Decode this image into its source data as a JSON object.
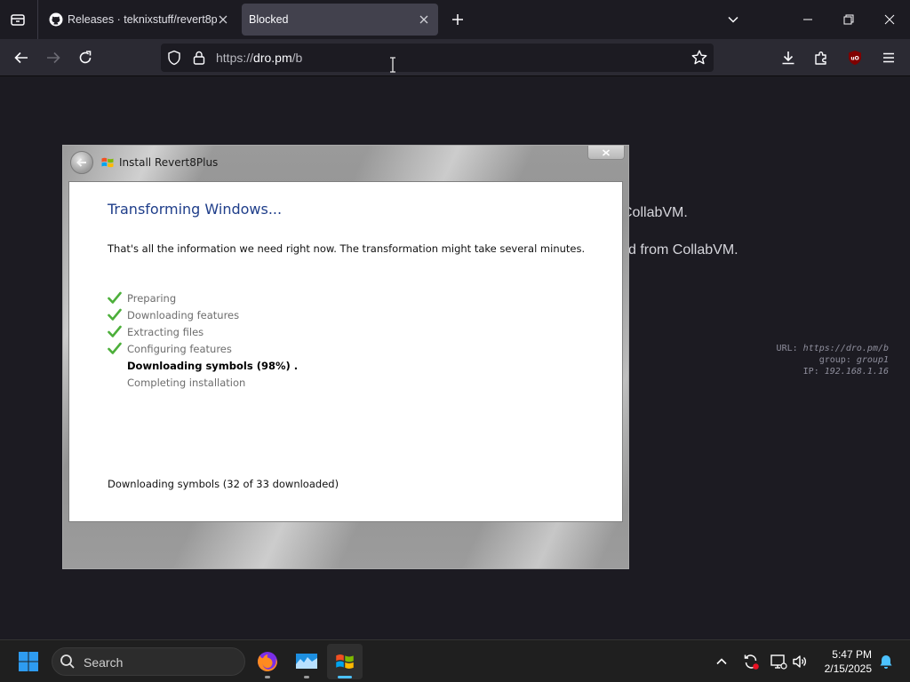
{
  "browser": {
    "tabs": [
      {
        "title": "Releases · teknixstuff/revert8plus",
        "active": false,
        "icon": "github-icon"
      },
      {
        "title": "Blocked",
        "active": true,
        "icon": ""
      }
    ],
    "url": {
      "scheme": "https://",
      "host": "dro.pm",
      "path": "/b"
    }
  },
  "page": {
    "line1_fragment": "CollabVM.",
    "line2_fragment": "d from CollabVM.",
    "meta": [
      {
        "key": "URL:",
        "value": "https://dro.pm/b"
      },
      {
        "key": "group:",
        "value": "group1"
      },
      {
        "key": "IP:",
        "value": "192.168.1.16"
      }
    ]
  },
  "installer": {
    "window_title": "Install Revert8Plus",
    "heading": "Transforming Windows...",
    "description": "That's all the information we need right now. The transformation might take several minutes.",
    "steps": [
      {
        "label": "Preparing",
        "state": "done"
      },
      {
        "label": "Downloading features",
        "state": "done"
      },
      {
        "label": "Extracting files",
        "state": "done"
      },
      {
        "label": "Configuring features",
        "state": "done"
      },
      {
        "label": "Downloading symbols (98%) .",
        "state": "current"
      },
      {
        "label": "Completing installation",
        "state": "pending"
      }
    ],
    "status": "Downloading symbols (32 of 33 downloaded)"
  },
  "taskbar": {
    "search_label": "Search",
    "apps": [
      "firefox-icon",
      "vm-viewer-icon",
      "windows-flag-icon"
    ],
    "time": "5:47 PM",
    "date": "2/15/2025"
  },
  "colors": {
    "heading": "#1f3e8a",
    "check": "#4caf3a",
    "active_tab": "#42414d",
    "taskbar_accent": "#4cc2ff"
  }
}
